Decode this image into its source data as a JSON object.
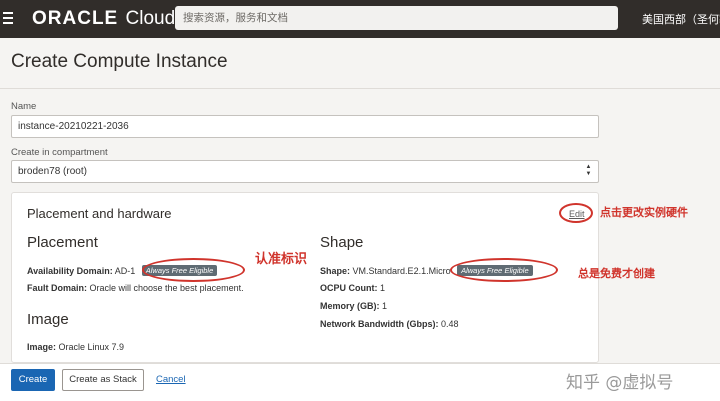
{
  "topbar": {
    "logo_brand": "ORACLE",
    "logo_product": "Cloud",
    "search_placeholder": "搜索资源，服务和文档",
    "region": "美国西部（圣何塞"
  },
  "page": {
    "title": "Create Compute Instance"
  },
  "form": {
    "name_label": "Name",
    "name_value": "instance-20210221-2036",
    "compartment_label": "Create in compartment",
    "compartment_value": "broden78 (root)"
  },
  "placement_hardware": {
    "title": "Placement and hardware",
    "edit_label": "Edit",
    "placement": {
      "heading": "Placement",
      "availability_domain_label": "Availability Domain:",
      "availability_domain_value": "AD-1",
      "badge": "Always Free Eligible",
      "fault_domain_label": "Fault Domain:",
      "fault_domain_value": "Oracle will choose the best placement."
    },
    "shape": {
      "heading": "Shape",
      "shape_label": "Shape:",
      "shape_value": "VM.Standard.E2.1.Micro",
      "badge": "Always Free Eligible",
      "ocpu_label": "OCPU Count:",
      "ocpu_value": "1",
      "memory_label": "Memory (GB):",
      "memory_value": "1",
      "bandwidth_label": "Network Bandwidth (Gbps):",
      "bandwidth_value": "0.48"
    },
    "image": {
      "heading": "Image",
      "image_label": "Image:",
      "image_value": "Oracle Linux 7.9"
    }
  },
  "annotations": {
    "edit_note": "点击更改实例硬件",
    "badge_note": "认准标识",
    "free_note": "总是免费才创建",
    "accent_color": "#d0342c"
  },
  "footer": {
    "create_label": "Create",
    "create_stack_label": "Create as Stack",
    "cancel_label": "Cancel",
    "watermark": "知乎 @虚拟号"
  },
  "colors": {
    "topbar": "#312d2a",
    "primary": "#1a66b3",
    "badge": "#5f6b73"
  }
}
